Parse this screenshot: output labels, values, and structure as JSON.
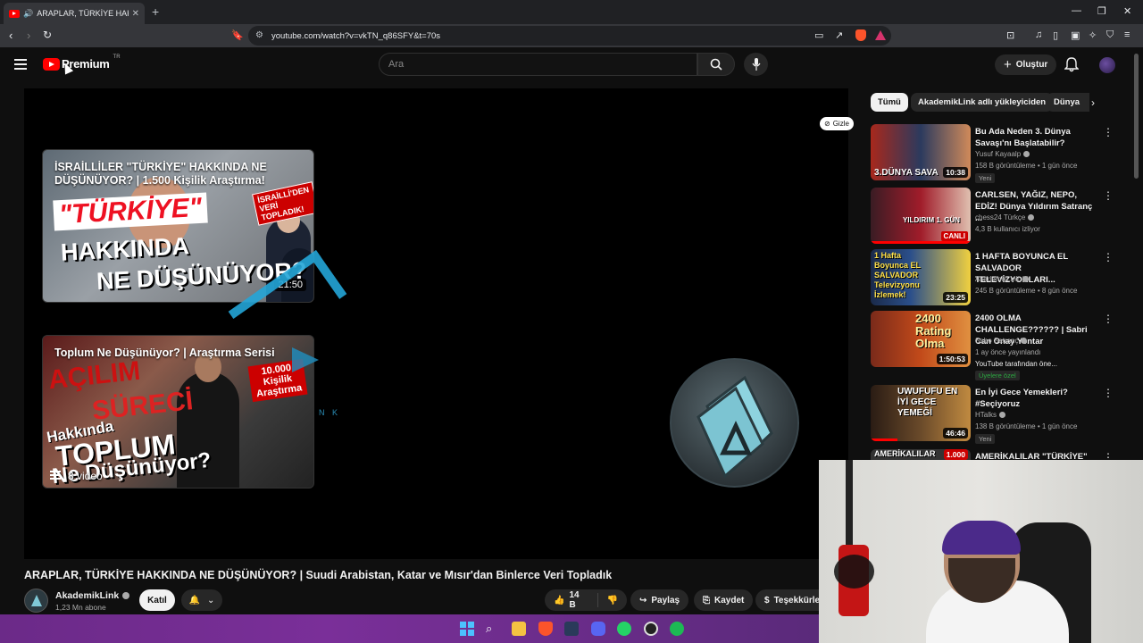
{
  "browser": {
    "tab_title": "ARAPLAR, TÜRKİYE HAKKINDA",
    "url": "youtube.com/watch?v=vkTN_q86SFY&t=70s",
    "colors": {
      "tabbar": "#202124",
      "toolbar": "#35363a",
      "brave": "#fb542b"
    }
  },
  "youtube": {
    "logo_text": "Premium",
    "region": "TR",
    "search_placeholder": "Ara",
    "create_label": "Oluştur",
    "colors": {
      "brand": "#ff0000",
      "background": "#0f0f0f"
    }
  },
  "player": {
    "hide_label": "Gizle",
    "card1": {
      "title": "İSRAİLLİLER \"TÜRKİYE\" HAKKINDA NE DÜŞÜNÜYOR? | 1.500 Kişilik Araştırma!",
      "text1": "\"TÜRKİYE\"",
      "text2": "HAKKINDA",
      "text3": "NE DÜŞÜNÜYOR?",
      "stamp": "İSRAİLLİ'DEN VERİ TOPLADIK!",
      "duration": "21:50"
    },
    "card2": {
      "title": "Toplum Ne Düşünüyor? | Araştırma Serisi",
      "text1": "AÇILIM",
      "text2": "SÜRECİ",
      "text3": "Hakkında",
      "text4": "TOPLUM",
      "text5": "Ne Düşünüyor?",
      "stamp": "10.000 Kişilik Araştırma",
      "playlist_count": "8 video"
    },
    "watermark_text": "N K"
  },
  "video": {
    "title": "ARAPLAR, TÜRKİYE HAKKINDA NE DÜŞÜNÜYOR? | Suudi Arabistan, Katar ve Mısır'dan Binlerce Veri Topladık",
    "channel": "AkademikLink",
    "subscribers": "1,23 Mn abone",
    "join_label": "Katıl",
    "likes": "14 B",
    "share_label": "Paylaş",
    "save_label": "Kaydet",
    "thanks_label": "Teşekkürle"
  },
  "sidebar": {
    "chips": [
      "Tümü",
      "AkademikLink adlı yükleyiciden",
      "Dünya"
    ],
    "items": [
      {
        "title": "Bu Ada Neden 3. Dünya Savaşı'nı Başlatabilir?",
        "channel": "Yusuf Kayaalp",
        "meta": "158 B görüntüleme • 1 gün önce",
        "badge": "Yeni",
        "thumb_label": "3.DÜNYA SAVA",
        "duration": "10:38"
      },
      {
        "title": "CARLSEN, YAĞIZ, NEPO, EDİZ! Dünya Yıldırım Satranç ...",
        "channel": "chess24 Türkçe",
        "meta": "4,3 B kullanıcı izliyor",
        "thumb_label": "YILDIRIM 1. GÜN",
        "live_label": "CANLI"
      },
      {
        "title": "1 HAFTA BOYUNCA EL SALVADOR TELEVİZYONLARI...",
        "channel": "AkademikLink",
        "meta": "245 B görüntüleme • 8 gün önce",
        "thumb_label": "1 Hafta Boyunca EL SALVADOR Televizyonu İzlemek!",
        "duration": "23:25"
      },
      {
        "title": "2400 OLMA CHALLENGE?????? | Sabri Can Onay Yontar",
        "channel": "Sabo Satranç",
        "meta": "1 ay önce yayınlandı",
        "meta2": "YouTube tarafından öne...",
        "badge": "Üyelere özel",
        "thumb_label": "2400 Rating Olma",
        "duration": "1:50:53"
      },
      {
        "title": "En İyi Gece Yemekleri? #Seçiyoruz",
        "channel": "HTalks",
        "meta": "138 B görüntüleme • 1 gün önce",
        "badge": "Yeni",
        "thumb_label": "UWUFUFU EN İYİ GECE YEMEĞİ",
        "duration": "46:46"
      },
      {
        "title": "AMERİKALILAR \"TÜRKİYE\"",
        "thumb_label": "AMERİKALILAR",
        "thumb_tag": "1.000"
      }
    ]
  }
}
